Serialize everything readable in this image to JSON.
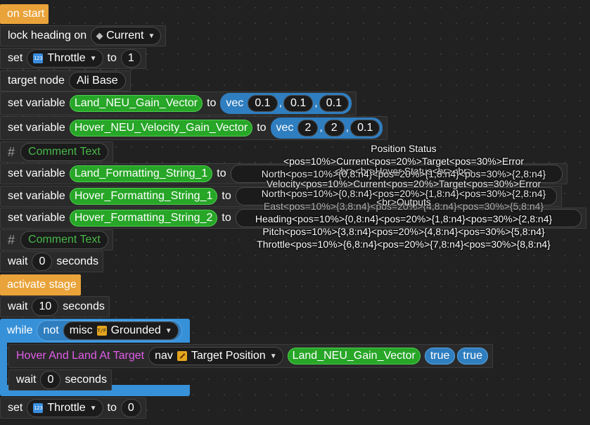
{
  "blocks": {
    "on_start": "on start",
    "lock_heading": {
      "label": "lock heading on",
      "value": "Current"
    },
    "set_throttle_1": {
      "set": "set",
      "var": "Throttle",
      "to": "to",
      "value": "1"
    },
    "target_node": {
      "label": "target node",
      "value": "Ali Base"
    },
    "set_var_land_gain": {
      "label": "set variable",
      "var": "Land_NEU_Gain_Vector",
      "to": "to",
      "vec": "vec",
      "x": "0.1",
      "y": "0.1",
      "z": "0.1"
    },
    "set_var_hover_gain": {
      "label": "set variable",
      "var": "Hover_NEU_Velocity_Gain_Vector",
      "to": "to",
      "vec": "vec",
      "x": "2",
      "y": "2",
      "z": "0.1"
    },
    "comment_1": "Comment Text",
    "set_var_land_fmt": {
      "label": "set variable",
      "var": "Land_Formatting_String_1",
      "to": "to"
    },
    "set_var_hover_fmt1": {
      "label": "set variable",
      "var": "Hover_Formatting_String_1",
      "to": "to"
    },
    "set_var_hover_fmt2": {
      "label": "set variable",
      "var": "Hover_Formatting_String_2",
      "to": "to"
    },
    "comment_2": "Comment Text",
    "wait_0": {
      "label": "wait",
      "value": "0",
      "unit": "seconds"
    },
    "activate_stage": "activate stage",
    "wait_10": {
      "label": "wait",
      "value": "10",
      "unit": "seconds"
    },
    "while_loop": {
      "label": "while",
      "not": "not",
      "misc": "misc",
      "cond": "Grounded"
    },
    "hover_land": {
      "label": "Hover And Land At Target",
      "nav": "nav",
      "target": "Target Position",
      "var": "Land_NEU_Gain_Vector",
      "b1": "true",
      "b2": "true"
    },
    "wait_inner": {
      "label": "wait",
      "value": "0",
      "unit": "seconds"
    },
    "set_throttle_0": {
      "set": "set",
      "var": "Throttle",
      "to": "to",
      "value": "0"
    }
  },
  "overlay": {
    "title": "Position Status",
    "line1": "<pos=10%>Current<pos=20%>Target<pos=30%>Error",
    "line2a": "North<pos=10%>{0,8:n4}<pos=20%>{1,8:n4}<pos=30%>{2,8:n4}",
    "line2b": "<br><br>Hover Status<br><br>",
    "line3a": "North<pos=10%>{0,8:n4}<pos=20%>{1,8:n4}<pos=30%>{2,8:n4}",
    "line3b": "Velocity<pos=10%>Current<pos=20%>Target<pos=30%>Error",
    "line4a": "<br>Outputs",
    "line4b": "East<pos=10%>{3,8:n4}<pos=20%>{4,8:n4}<pos=30%>{5,8:n4}",
    "line5": "Heading<pos=10%>{0,8:n4}<pos=20%>{1,8:n4}<pos=30%>{2,8:n4}",
    "line6": "Pitch<pos=10%>{3,8:n4}<pos=20%>{4,8:n4}<pos=30%>{5,8:n4}",
    "line7": "Throttle<pos=10%>{6,8:n4}<pos=20%>{7,8:n4}<pos=30%>{8,8:n4}"
  },
  "colors": {
    "canvas": "#212121",
    "event_block": "#e9a33a",
    "variable": "#27a627",
    "vector": "#2f7ec0",
    "loop": "#3691d9",
    "hover_label": "#e25ce9"
  }
}
